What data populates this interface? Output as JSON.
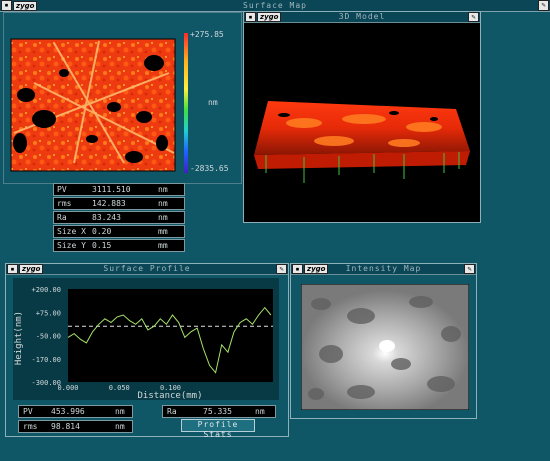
{
  "app": {
    "window_title": "Surface Map",
    "logo_text": "zygo"
  },
  "surface_map": {
    "scale_top": "+275.85",
    "scale_mid": "nm",
    "scale_bottom": "-2835.65"
  },
  "stats": [
    {
      "label": "PV",
      "value": "3111.510",
      "unit": "nm"
    },
    {
      "label": "rms",
      "value": "142.883",
      "unit": "nm"
    },
    {
      "label": "Ra",
      "value": "83.243",
      "unit": "nm"
    },
    {
      "label": "Size X",
      "value": "0.20",
      "unit": "mm"
    },
    {
      "label": "Size Y",
      "value": "0.15",
      "unit": "mm"
    }
  ],
  "model3d": {
    "title": "3D Model"
  },
  "profile": {
    "title": "Surface Profile",
    "ylabel": "Height(nm)",
    "xlabel": "Distance(mm)",
    "pv": {
      "label": "PV",
      "value": "453.996",
      "unit": "nm"
    },
    "rms": {
      "label": "rms",
      "value": "98.814",
      "unit": "nm"
    },
    "ra": {
      "label": "Ra",
      "value": "75.335",
      "unit": "nm"
    },
    "stats_button": "Profile Stats"
  },
  "intensity": {
    "title": "Intensity Map"
  },
  "chart_data": {
    "type": "line",
    "title": "Surface Profile",
    "xlabel": "Distance(mm)",
    "ylabel": "Height(nm)",
    "xlim": [
      0.0,
      0.2
    ],
    "ylim": [
      -300.0,
      200.0
    ],
    "x_ticks": [
      "0.000",
      "0.050",
      "0.100"
    ],
    "y_ticks": [
      "+200.00",
      "+75.00",
      "-50.00",
      "-170.00",
      "-300.00"
    ],
    "reference_line": 0,
    "series": [
      {
        "color": "#a6e36b",
        "x": [
          0.0,
          0.006,
          0.012,
          0.018,
          0.024,
          0.03,
          0.036,
          0.042,
          0.048,
          0.054,
          0.06,
          0.066,
          0.072,
          0.078,
          0.084,
          0.09,
          0.096,
          0.102,
          0.108,
          0.114,
          0.12,
          0.126,
          0.132,
          0.138,
          0.144,
          0.15,
          0.156,
          0.162,
          0.168,
          0.174,
          0.18,
          0.186,
          0.192,
          0.198
        ],
        "y": [
          -60,
          -40,
          -70,
          -90,
          -30,
          10,
          40,
          20,
          50,
          60,
          30,
          10,
          40,
          -20,
          0,
          40,
          10,
          60,
          20,
          -60,
          -30,
          -10,
          -120,
          -210,
          -250,
          -100,
          -140,
          -30,
          20,
          40,
          10,
          60,
          100,
          60
        ]
      }
    ]
  }
}
